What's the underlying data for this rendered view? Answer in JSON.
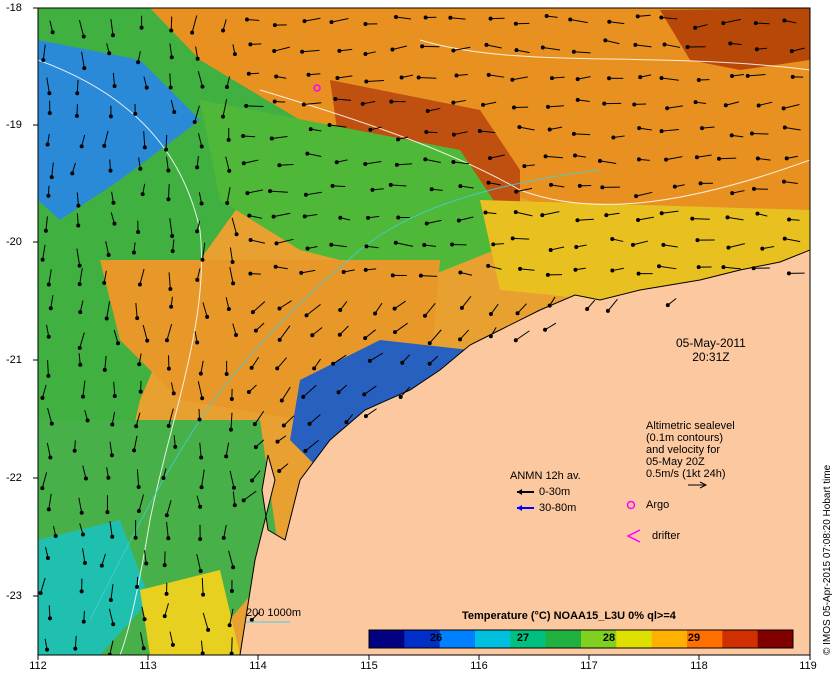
{
  "map": {
    "x_ticks": [
      "112",
      "113",
      "114",
      "115",
      "116",
      "117",
      "118",
      "119"
    ],
    "y_ticks": [
      "-18",
      "-19",
      "-20",
      "-21",
      "-22",
      "-23"
    ],
    "date": "05-May-2011",
    "time": "20:31Z",
    "credit": "© IMOS 05-Apr-2015 07:08:20 Hobart time"
  },
  "annotations": {
    "altimetric": [
      "Altimetric sealevel",
      "(0.1m contours)",
      "and velocity for",
      "05-May 20Z",
      "0.5m/s (1kt 24h)"
    ],
    "anmn_title": "ANMN 12h av.",
    "anmn_0_30": "0-30m",
    "anmn_30_80": "30-80m",
    "argo": "Argo",
    "drifter": "drifter",
    "depth_contours": "200  1000m"
  },
  "colorbar": {
    "title": "Temperature (°C) NOAA15_L3U 0% ql>=4",
    "ticks": [
      "26",
      "27",
      "28",
      "29"
    ],
    "colors": [
      "#000080",
      "#0030c8",
      "#0080ff",
      "#00c0e0",
      "#00c080",
      "#20b040",
      "#80d020",
      "#e0e000",
      "#ffb000",
      "#ff7000",
      "#d03000",
      "#800000"
    ]
  },
  "colors": {
    "land": "#fbc8a0",
    "background_sea": "#e8a030"
  }
}
